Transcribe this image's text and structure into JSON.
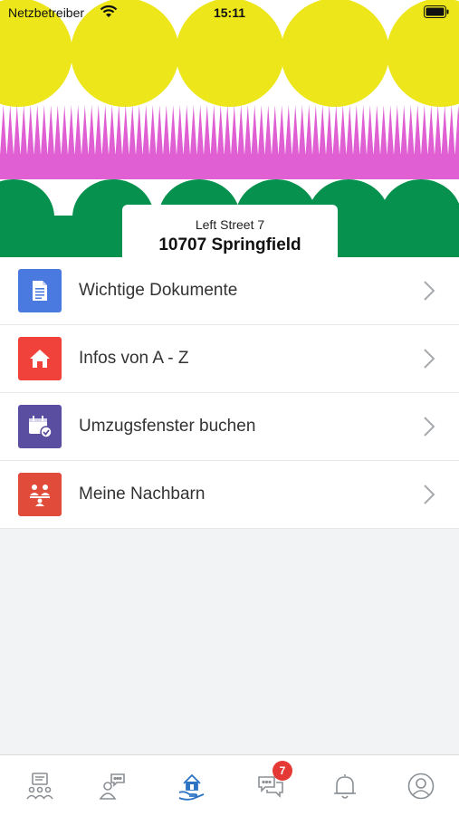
{
  "status_bar": {
    "carrier": "Netzbetreiber",
    "time": "15:11",
    "wifi_icon": "wifi-icon",
    "battery_icon": "battery-icon"
  },
  "header_art": {
    "colors": {
      "yellow": "#ece61b",
      "pink": "#e05fd3",
      "green": "#07914f"
    }
  },
  "address": {
    "street": "Left Street 7",
    "city": "10707 Springfield"
  },
  "menu": {
    "items": [
      {
        "label": "Wichtige Dokumente",
        "icon": "document-icon",
        "color": "#4a79e0"
      },
      {
        "label": "Infos von A - Z",
        "icon": "home-icon",
        "color": "#f0413a"
      },
      {
        "label": "Umzugsfenster buchen",
        "icon": "calendar-check-icon",
        "color": "#5a4ea0"
      },
      {
        "label": "Meine Nachbarn",
        "icon": "neighbors-icon",
        "color": "#e04b3a"
      }
    ]
  },
  "tabbar": {
    "tabs": [
      {
        "icon": "community-icon"
      },
      {
        "icon": "chat-person-icon"
      },
      {
        "icon": "home-hand-icon",
        "active": true
      },
      {
        "icon": "messages-icon",
        "badge": "7"
      },
      {
        "icon": "bell-icon"
      },
      {
        "icon": "profile-icon"
      }
    ],
    "active_color": "#2c73c4",
    "inactive_color": "#8a8f94",
    "badge_color": "#e53935"
  }
}
